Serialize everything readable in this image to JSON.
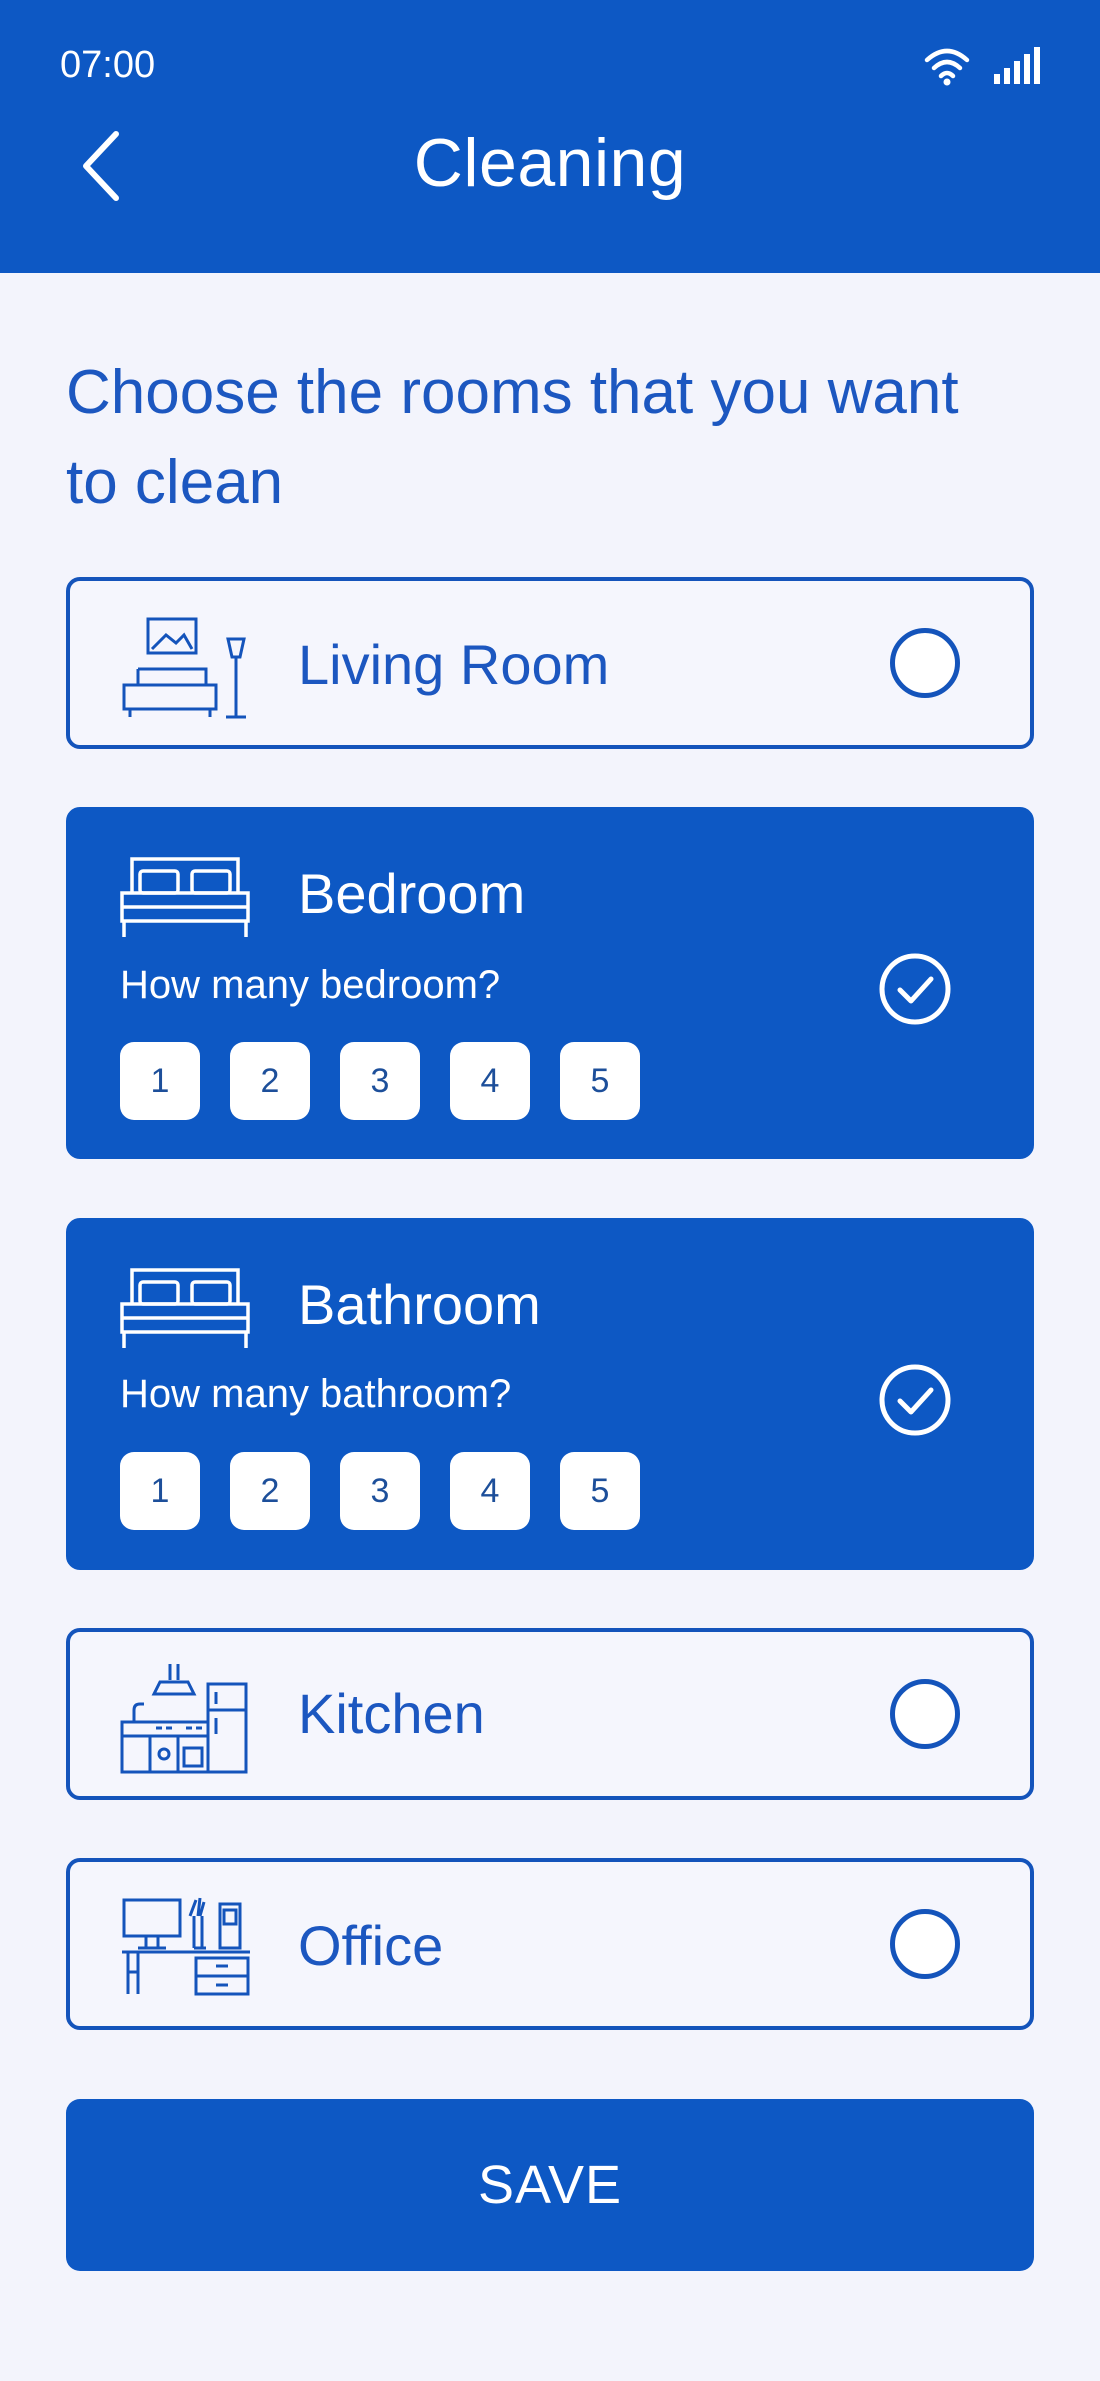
{
  "status_bar": {
    "time": "07:00"
  },
  "header": {
    "title": "Cleaning"
  },
  "prompt": "Choose the rooms that you want to clean",
  "rooms": [
    {
      "label": "Living Room",
      "selected": false,
      "icon": "living-room-icon"
    },
    {
      "label": "Bedroom",
      "selected": true,
      "icon": "bed-icon",
      "question": "How many bedroom?",
      "options": [
        "1",
        "2",
        "3",
        "4",
        "5"
      ]
    },
    {
      "label": "Bathroom",
      "selected": true,
      "icon": "bed-icon",
      "question": "How many bathroom?",
      "options": [
        "1",
        "2",
        "3",
        "4",
        "5"
      ]
    },
    {
      "label": "Kitchen",
      "selected": false,
      "icon": "kitchen-icon"
    },
    {
      "label": "Office",
      "selected": false,
      "icon": "office-desk-icon"
    }
  ],
  "save_label": "SAVE",
  "colors": {
    "primary": "#0d58c4",
    "background": "#f3f4fc",
    "text": "#1c57c0"
  }
}
